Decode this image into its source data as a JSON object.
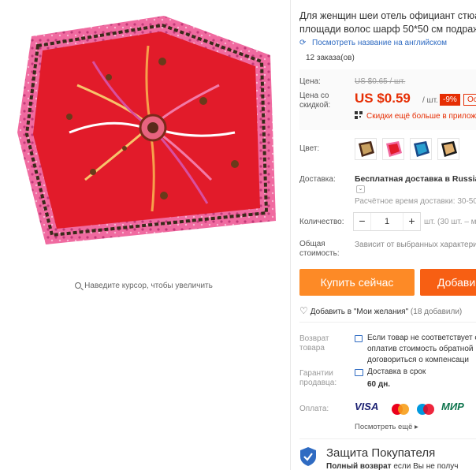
{
  "product": {
    "title_line1": "Для женщин шеи отель официант стюа",
    "title_line2": "площади волос шарф 50*50 см подраж",
    "translate_link": "Посмотреть название на английском",
    "orders": "12 заказа(ов)"
  },
  "price": {
    "price_label": "Цена:",
    "old_price": "US $0.65 / шт.",
    "discount_label_line1": "Цена со",
    "discount_label_line2": "скидкой:",
    "new_price": "US $0.59",
    "per_unit": "/ шт.",
    "discount_badge": "-9%",
    "extra_badge": "Ос",
    "coupon_text": "Скидки ещё больше в прилож"
  },
  "color": {
    "label": "Цвет:",
    "swatches": [
      "scarf-brown",
      "scarf-red",
      "scarf-blue",
      "scarf-black"
    ]
  },
  "shipping": {
    "label": "Доставка:",
    "value": "Бесплатная доставка в Russian",
    "dropdown_icon": "chevron-down-icon",
    "eta": "Расчётное время доставки: 30-50"
  },
  "quantity": {
    "label": "Количество:",
    "minus": "−",
    "value": "1",
    "plus": "+",
    "unit_text": "шт. (30 шт. – м"
  },
  "total": {
    "label_line1": "Общая",
    "label_line2": "стоимость:",
    "value": "Зависит от выбранных характери"
  },
  "actions": {
    "buy_now": "Купить сейчас",
    "add_to_cart": "Добави",
    "wishlist": "Добавить в \"Мои желания\"",
    "wishlist_count": "(18 добавили)"
  },
  "returns": {
    "label_line1": "Возврат",
    "label_line2": "товара",
    "text_line1": "Если товар не соответствует с",
    "text_line2": "оплатив стоимость обратной",
    "text_line3": "договориться о компенсаци"
  },
  "guarantee": {
    "label_line1": "Гарантии",
    "label_line2": "продавца:",
    "text": "Доставка в срок",
    "days": "60 дн."
  },
  "payment": {
    "label": "Оплата:",
    "visa": "VISA",
    "mir": "МИР",
    "more": "Посмотреть ещё ▸"
  },
  "protection": {
    "title": "Защита Покупателя",
    "sub_bold": "Полный возврат",
    "sub_rest": " если Вы не получ"
  },
  "gallery": {
    "zoom_hint": "Наведите курсор, чтобы увеличить"
  },
  "colors": {
    "accent_red": "#e62e04",
    "buy_orange": "#fd8a26",
    "cart_orange": "#f75f13",
    "link_blue": "#2f6bc2"
  }
}
